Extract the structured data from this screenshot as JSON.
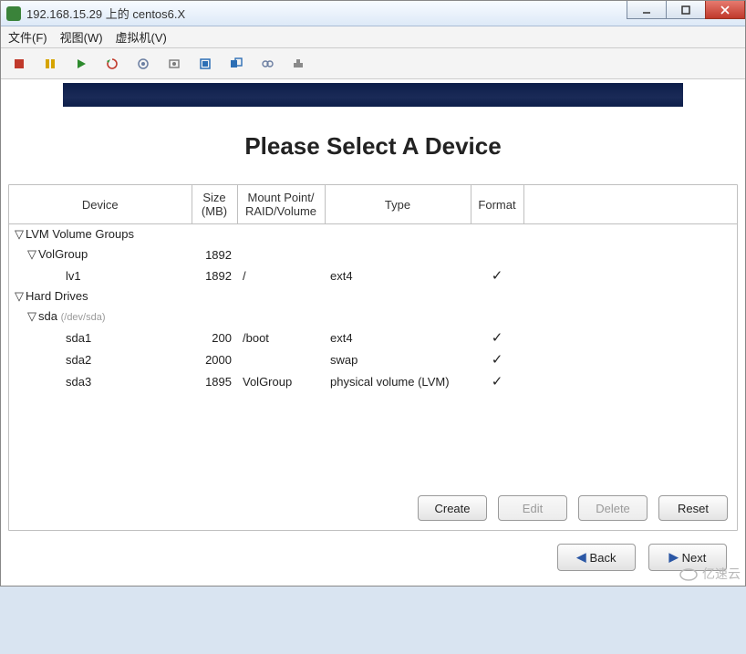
{
  "window": {
    "title": "192.168.15.29 上的 centos6.X"
  },
  "menubar": {
    "file": "文件(F)",
    "view": "视图(W)",
    "vm": "虚拟机(V)"
  },
  "heading": "Please Select A Device",
  "columns": {
    "device": "Device",
    "size": "Size\n(MB)",
    "mount": "Mount Point/\nRAID/Volume",
    "type": "Type",
    "format": "Format"
  },
  "tree": {
    "lvm_group_label": "LVM Volume Groups",
    "volgroup": {
      "name": "VolGroup",
      "size": "1892"
    },
    "lv1": {
      "name": "lv1",
      "size": "1892",
      "mount": "/",
      "type": "ext4",
      "format": true
    },
    "hard_drives_label": "Hard Drives",
    "sda_name": "sda",
    "sda_sub": "(/dev/sda)",
    "sda1": {
      "name": "sda1",
      "size": "200",
      "mount": "/boot",
      "type": "ext4",
      "format": true
    },
    "sda2": {
      "name": "sda2",
      "size": "2000",
      "mount": "",
      "type": "swap",
      "format": true
    },
    "sda3": {
      "name": "sda3",
      "size": "1895",
      "mount": "VolGroup",
      "type": "physical volume (LVM)",
      "format": true
    }
  },
  "panel_buttons": {
    "create": "Create",
    "edit": "Edit",
    "delete": "Delete",
    "reset": "Reset"
  },
  "nav": {
    "back": "Back",
    "next": "Next"
  },
  "watermark": "亿速云"
}
